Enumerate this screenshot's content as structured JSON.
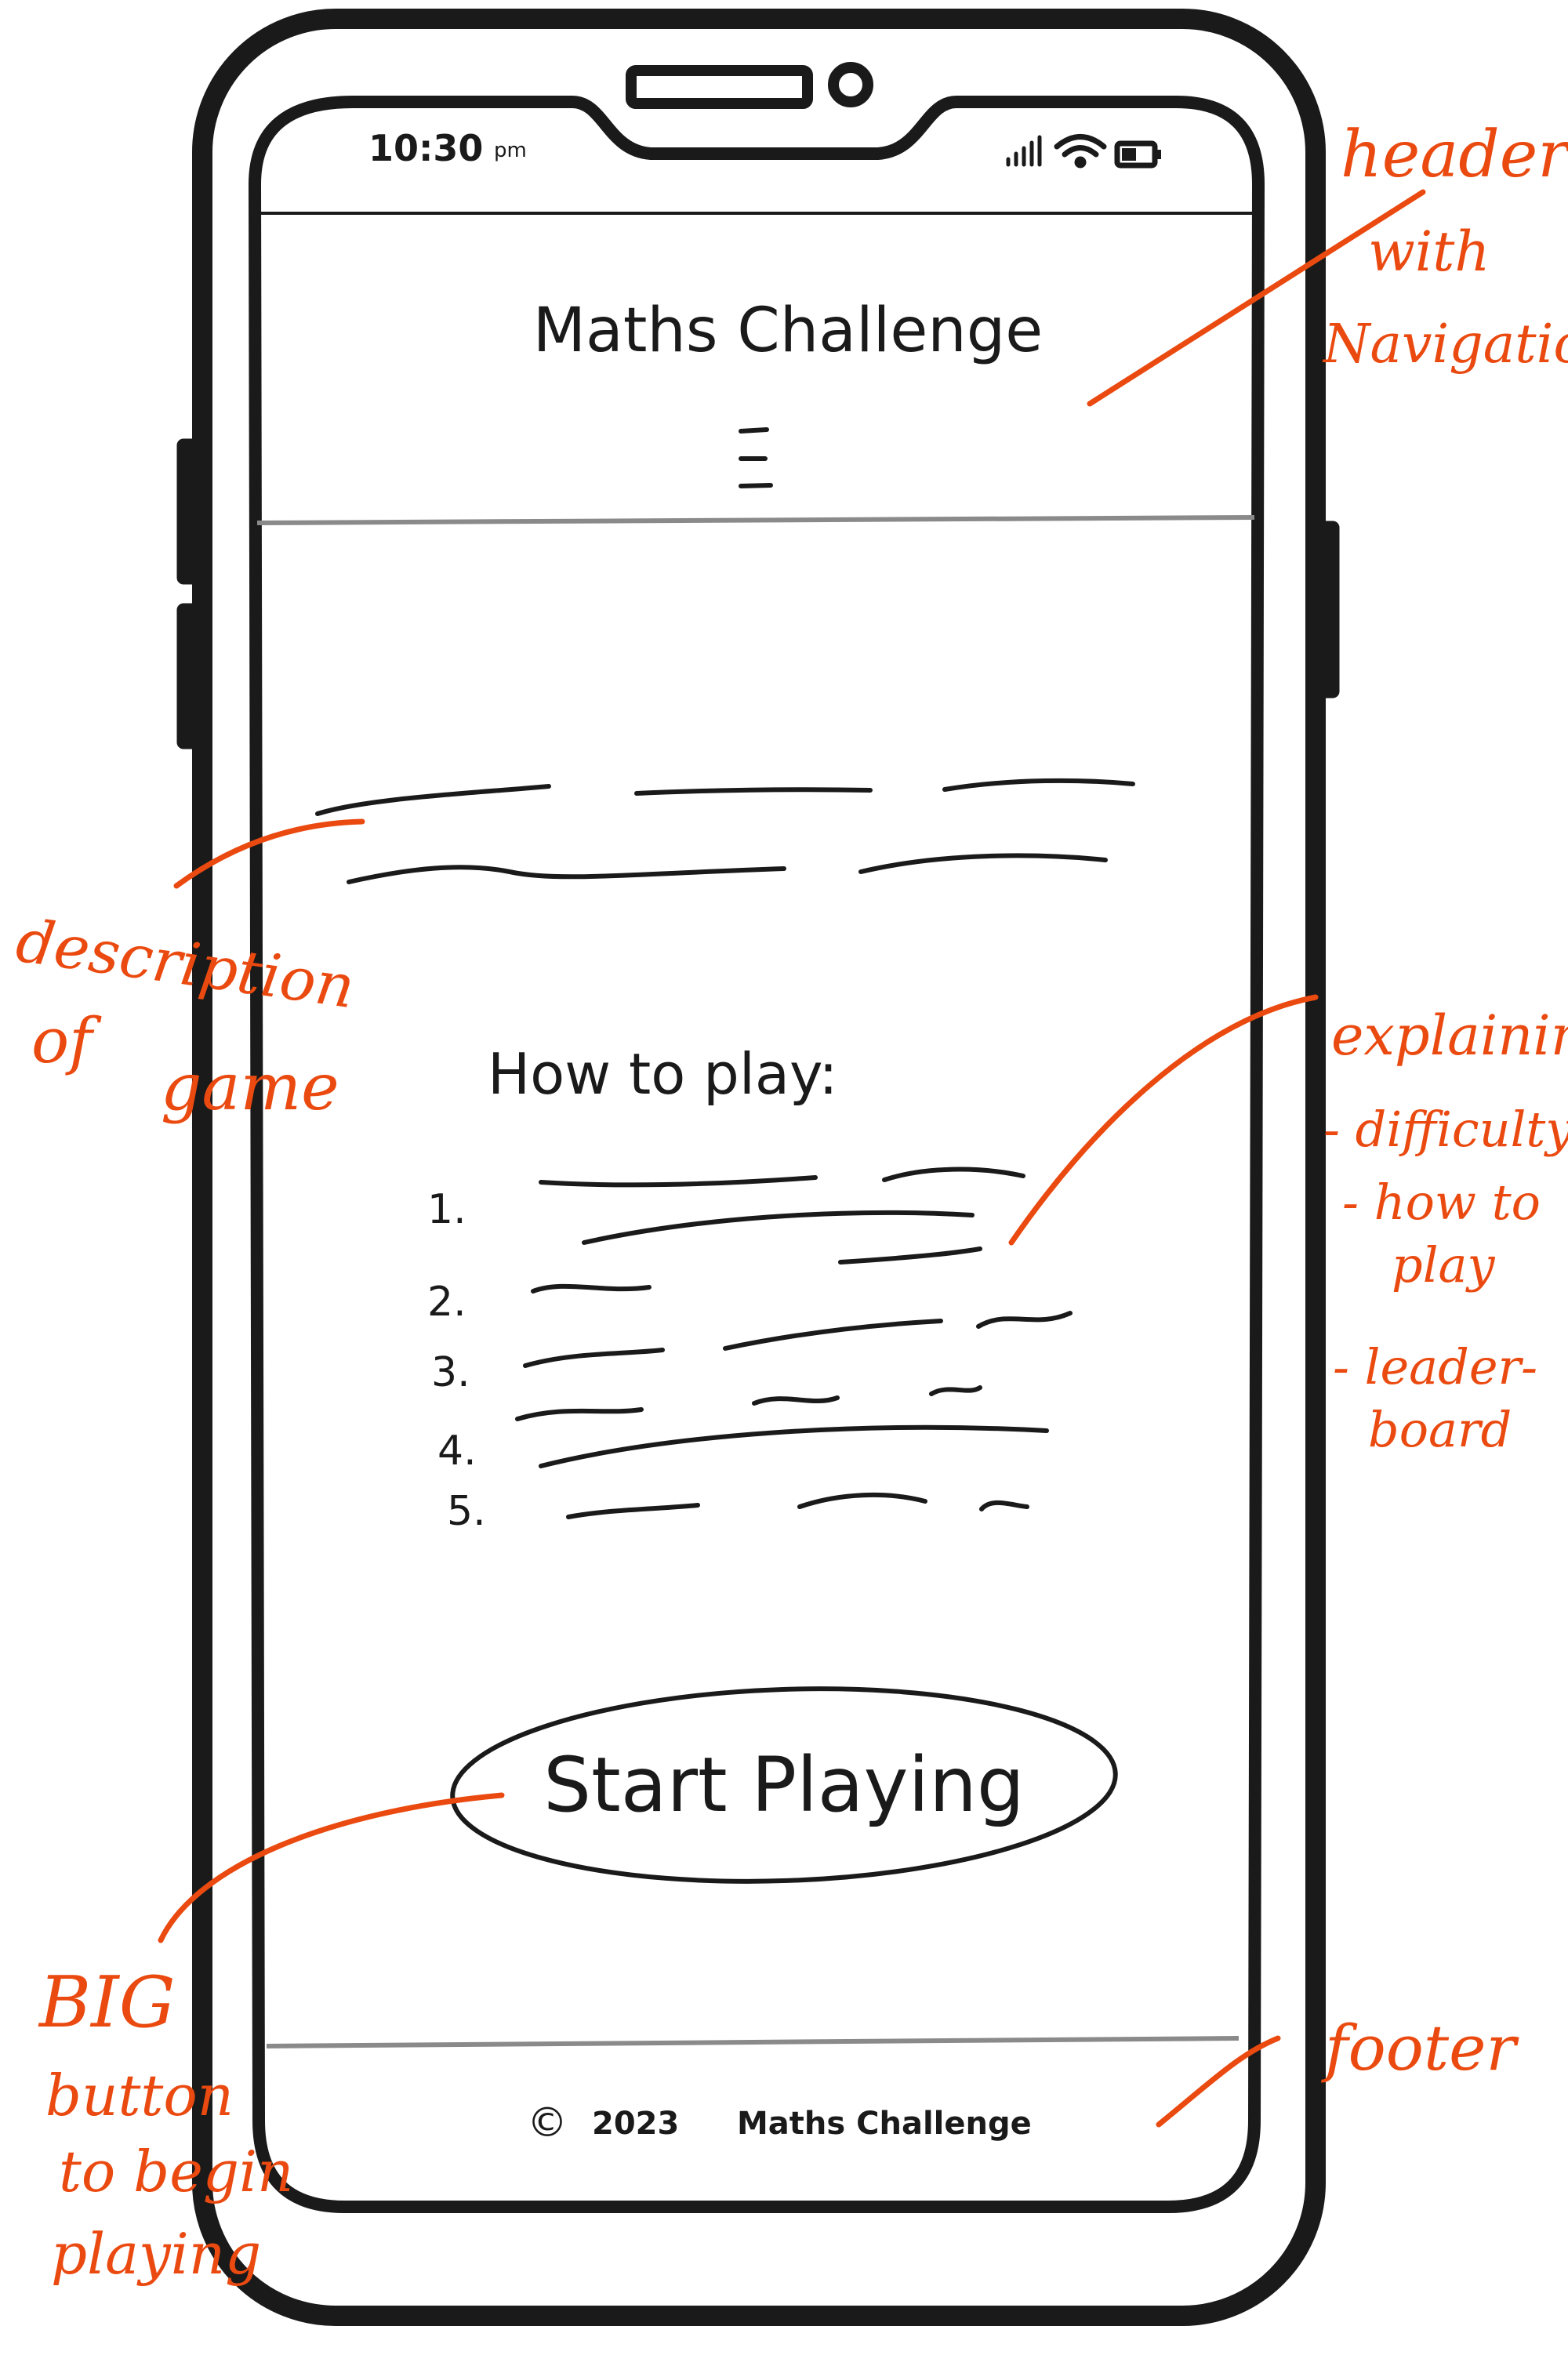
{
  "phone": {
    "status_bar": {
      "time": "10:30",
      "ampm": "pm"
    },
    "header": {
      "title": "Maths Challenge"
    },
    "main": {
      "how_to_play_heading": "How to play:",
      "steps": [
        "1.",
        "2.",
        "3.",
        "4.",
        "5."
      ],
      "start_button_label": "Start Playing"
    },
    "footer": {
      "copyright_symbol": "©",
      "year": "2023",
      "name": "Maths Challenge"
    }
  },
  "annotations": {
    "header": [
      "header",
      "with",
      "Navigation"
    ],
    "description": [
      "description",
      "of",
      "game"
    ],
    "explaining": [
      "explaining",
      "- difficulty",
      "- how to",
      "play",
      "- leader-",
      "board"
    ],
    "button": [
      "BIG",
      "button",
      "to begin",
      "playing"
    ],
    "footer": [
      "footer"
    ]
  },
  "colors": {
    "ink": "#1a1a1a",
    "annotation": "#ea4a10",
    "divider": "#8a8a8a",
    "background": "#ffffff"
  }
}
